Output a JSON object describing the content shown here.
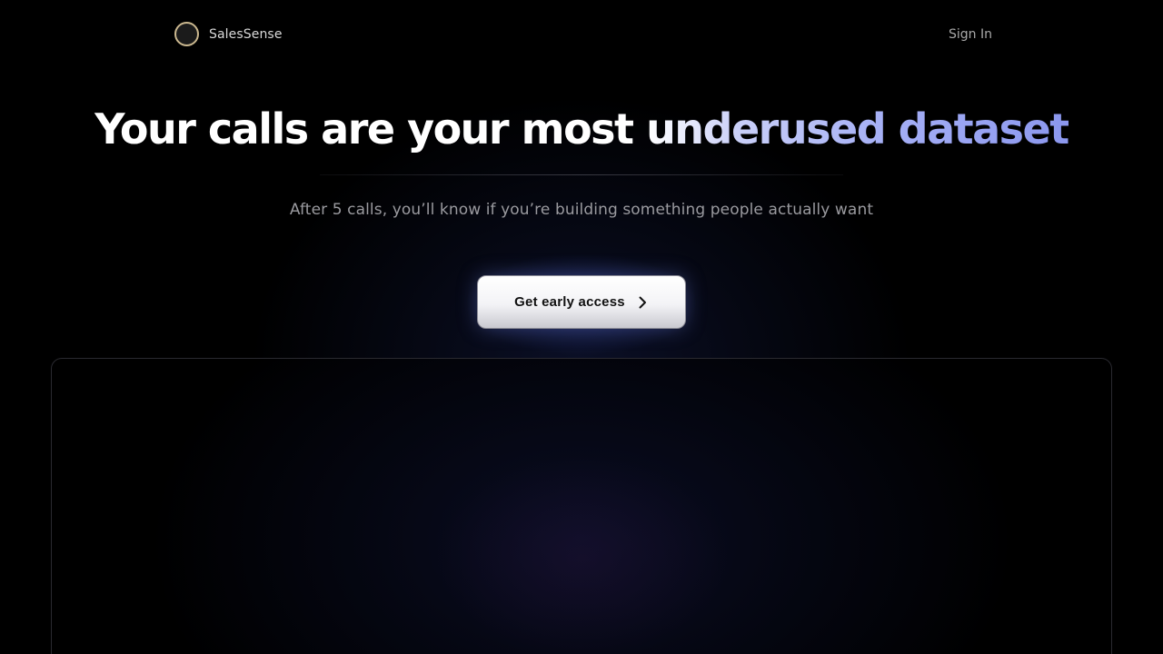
{
  "nav": {
    "brand": "SalesSense",
    "sign_in": "Sign In"
  },
  "hero": {
    "headline_plain": "Your calls are your most ",
    "headline_highlight": "underused dataset",
    "subtitle": "After 5 calls, you’ll know if you’re building something people actually want",
    "cta_label": "Get early access",
    "cta_icon": "chevron-right-icon"
  },
  "colors": {
    "background": "#000000",
    "logo_ring": "#cbb88f",
    "highlight_start": "#c9cff8",
    "highlight_end": "#8b97ee",
    "subtitle": "#9a9a9f"
  }
}
